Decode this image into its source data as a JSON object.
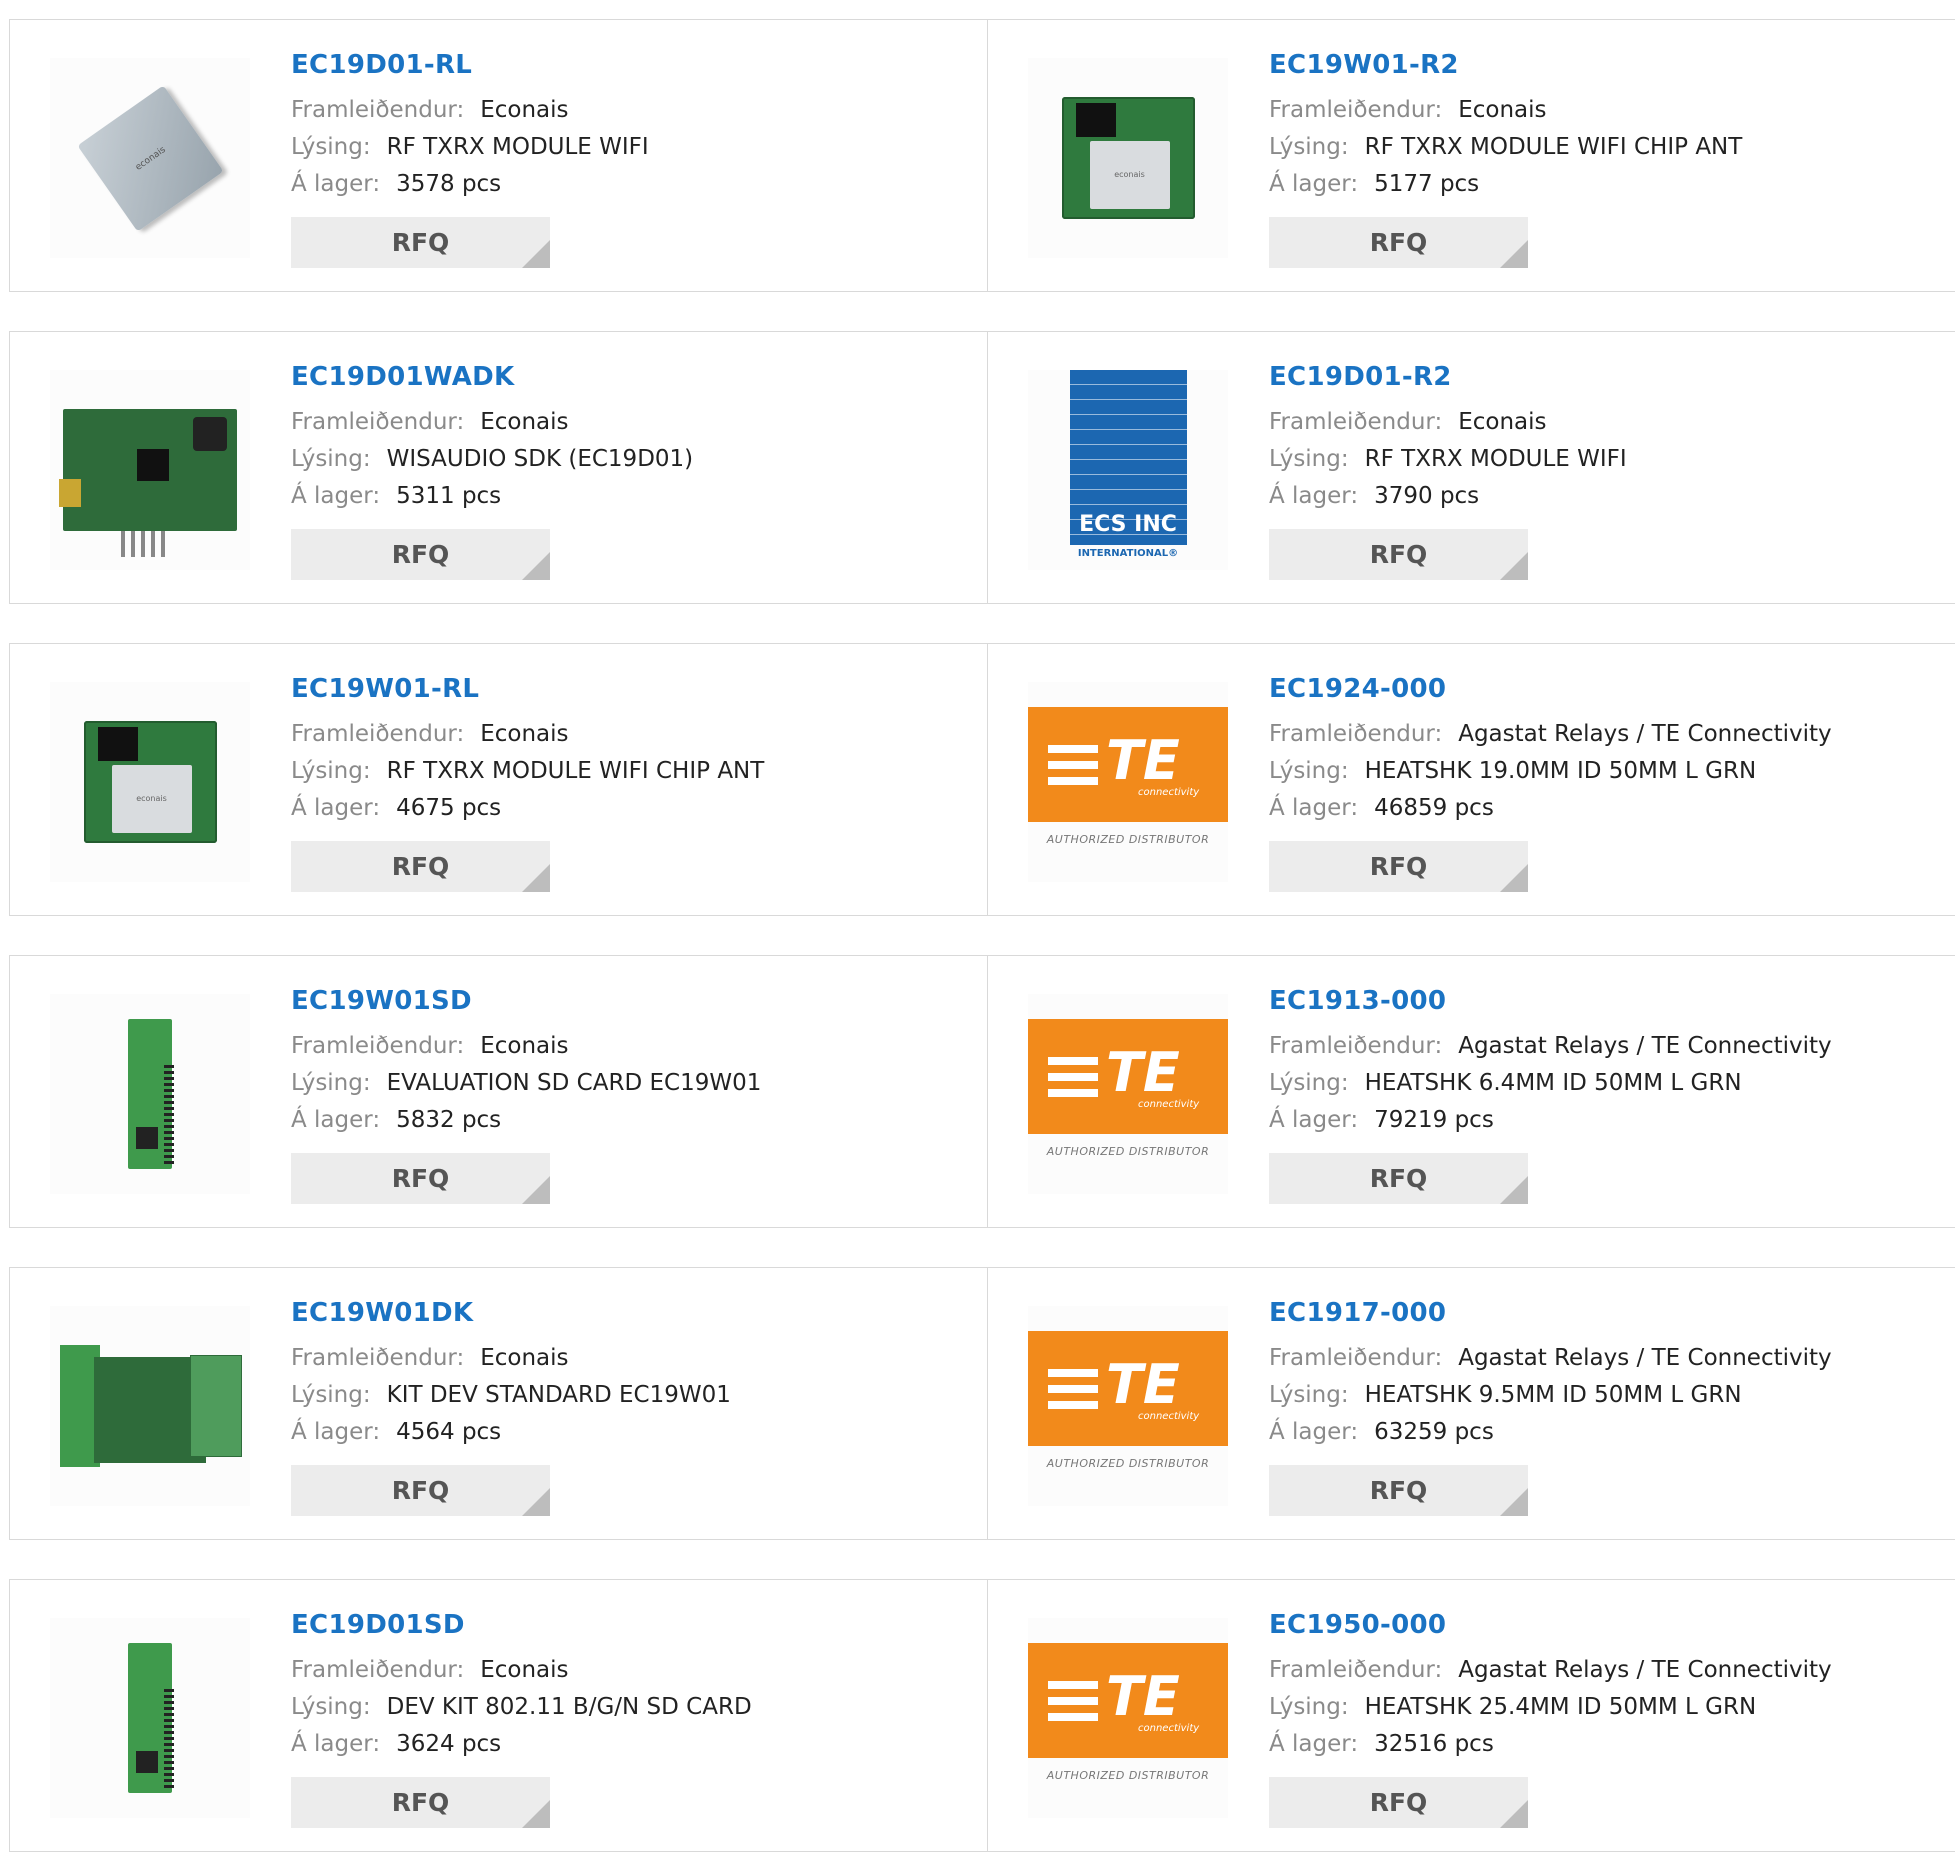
{
  "labels": {
    "manufacturer": "Framleiðendur:",
    "description": "Lýsing:",
    "stock": "Á lager:",
    "rfq": "RFQ"
  },
  "products": [
    {
      "pn": "EC19D01-RL",
      "manufacturer": "Econais",
      "description": "RF TXRX MODULE WIFI",
      "stock": "3578 pcs",
      "image": "silver-module"
    },
    {
      "pn": "EC19W01-R2",
      "manufacturer": "Econais",
      "description": "RF TXRX MODULE WIFI CHIP ANT",
      "stock": "5177 pcs",
      "image": "pcb-module"
    },
    {
      "pn": "EC19D01WADK",
      "manufacturer": "Econais",
      "description": "WISAUDIO SDK (EC19D01)",
      "stock": "5311 pcs",
      "image": "dev-board"
    },
    {
      "pn": "EC19D01-R2",
      "manufacturer": "Econais",
      "description": "RF TXRX MODULE WIFI",
      "stock": "3790 pcs",
      "image": "ecs-logo",
      "logo_text": "ECS INC",
      "logo_sub": "INTERNATIONAL®"
    },
    {
      "pn": "EC19W01-RL",
      "manufacturer": "Econais",
      "description": "RF TXRX MODULE WIFI CHIP ANT",
      "stock": "4675 pcs",
      "image": "pcb-module"
    },
    {
      "pn": "EC1924-000",
      "manufacturer": "Agastat Relays / TE Connectivity",
      "description": "HEATSHK 19.0MM ID 50MM L GRN",
      "stock": "46859 pcs",
      "image": "te-logo"
    },
    {
      "pn": "EC19W01SD",
      "manufacturer": "Econais",
      "description": "EVALUATION SD CARD EC19W01",
      "stock": "5832 pcs",
      "image": "sd-card"
    },
    {
      "pn": "EC1913-000",
      "manufacturer": "Agastat Relays / TE Connectivity",
      "description": "HEATSHK 6.4MM ID 50MM L GRN",
      "stock": "79219 pcs",
      "image": "te-logo"
    },
    {
      "pn": "EC19W01DK",
      "manufacturer": "Econais",
      "description": "KIT DEV STANDARD EC19W01",
      "stock": "4564 pcs",
      "image": "dev-kit"
    },
    {
      "pn": "EC1917-000",
      "manufacturer": "Agastat Relays / TE Connectivity",
      "description": "HEATSHK 9.5MM ID 50MM L GRN",
      "stock": "63259 pcs",
      "image": "te-logo"
    },
    {
      "pn": "EC19D01SD",
      "manufacturer": "Econais",
      "description": "DEV KIT 802.11 B/G/N SD CARD",
      "stock": "3624 pcs",
      "image": "sd-card"
    },
    {
      "pn": "EC1950-000",
      "manufacturer": "Agastat Relays / TE Connectivity",
      "description": "HEATSHK 25.4MM ID 50MM L GRN",
      "stock": "32516 pcs",
      "image": "te-logo"
    }
  ],
  "te_logo": {
    "mark": "TE",
    "sub": "connectivity",
    "caption": "AUTHORIZED DISTRIBUTOR"
  },
  "colors": {
    "link": "#1a73c3",
    "te_orange": "#f28a1b",
    "ecs_blue": "#1c67b1"
  }
}
